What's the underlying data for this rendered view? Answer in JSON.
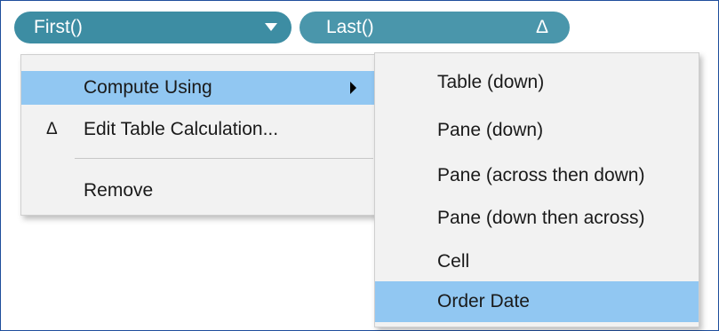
{
  "pills": {
    "first": {
      "label": "First()",
      "caret": "chevron-down-icon"
    },
    "last": {
      "label": "Last()",
      "delta": "Δ"
    }
  },
  "context_menu": {
    "items": [
      {
        "label": "Compute Using",
        "highlighted": true,
        "submenu_arrow": true
      },
      {
        "label": "Edit Table Calculation...",
        "icon": "Δ"
      },
      {
        "label": "Remove"
      }
    ]
  },
  "submenu": {
    "items": [
      {
        "label": "Table (down)"
      },
      {
        "label": "Pane (down)"
      },
      {
        "label": "Pane (across then down)"
      },
      {
        "label": "Pane (down then across)"
      },
      {
        "label": "Cell"
      },
      {
        "label": "Order Date",
        "selected": true
      }
    ]
  },
  "colors": {
    "pill": "#3d8da3",
    "highlight": "#91c7f2",
    "menu_bg": "#f2f2f2"
  }
}
